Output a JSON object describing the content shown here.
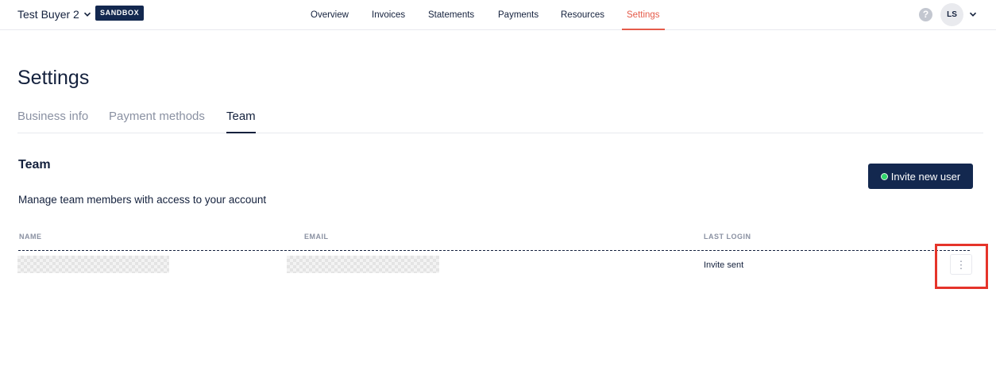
{
  "header": {
    "account_name": "Test Buyer 2",
    "environment_badge": "SANDBOX",
    "nav": [
      {
        "label": "Overview"
      },
      {
        "label": "Invoices"
      },
      {
        "label": "Statements"
      },
      {
        "label": "Payments"
      },
      {
        "label": "Resources"
      },
      {
        "label": "Settings",
        "active": true
      }
    ],
    "help_glyph": "?",
    "avatar_initials": "LS"
  },
  "page": {
    "title": "Settings",
    "tabs": [
      {
        "label": "Business info"
      },
      {
        "label": "Payment methods"
      },
      {
        "label": "Team",
        "active": true
      }
    ]
  },
  "team": {
    "title": "Team",
    "description": "Manage team members with access to your account",
    "invite_button_label": "Invite new user",
    "columns": [
      "NAME",
      "EMAIL",
      "LAST LOGIN"
    ],
    "rows": [
      {
        "name": "",
        "email": "",
        "last_login": "Invite sent",
        "menu_glyph": "⋮"
      }
    ]
  },
  "colors": {
    "brand_navy": "#13284f",
    "accent_active": "#e55b4a",
    "status_green": "#2fd66b",
    "highlight_red": "#e5342a"
  },
  "icons": [
    "chevron-down-icon",
    "help-icon",
    "status-dot-icon",
    "more-vertical-icon"
  ]
}
